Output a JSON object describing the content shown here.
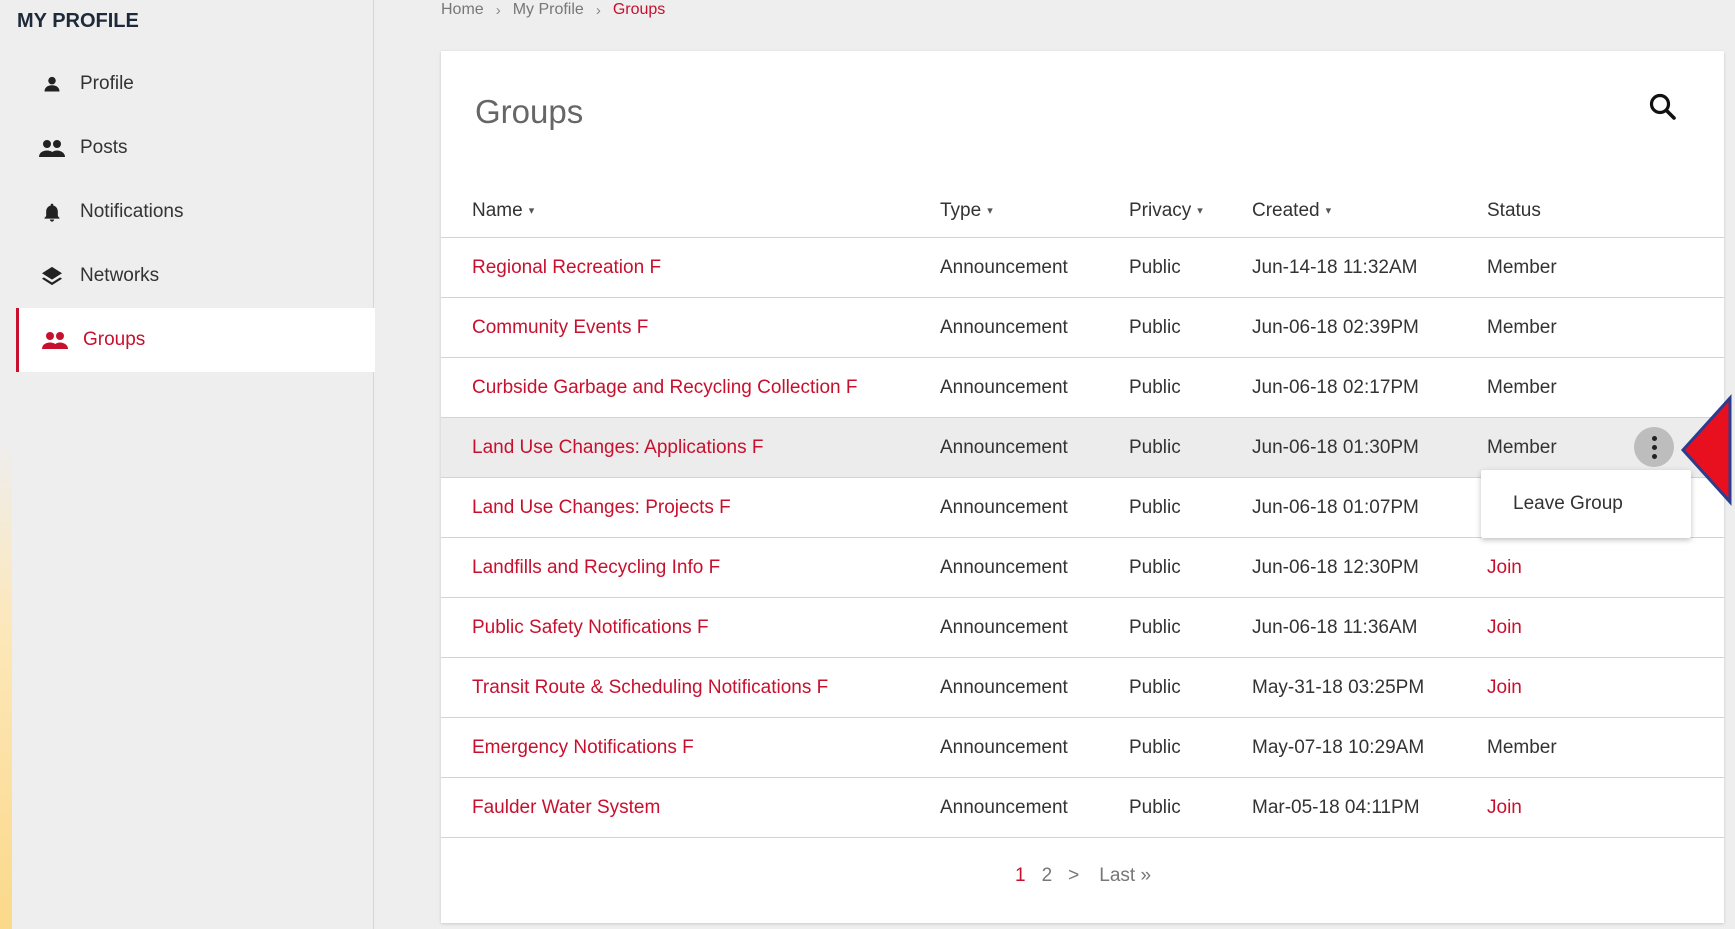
{
  "sidebar": {
    "title": "MY PROFILE",
    "items": [
      {
        "label": "Profile",
        "icon": "person-icon"
      },
      {
        "label": "Posts",
        "icon": "people-icon"
      },
      {
        "label": "Notifications",
        "icon": "bell-icon"
      },
      {
        "label": "Networks",
        "icon": "layers-icon"
      },
      {
        "label": "Groups",
        "icon": "people-icon",
        "active": true
      }
    ]
  },
  "breadcrumb": {
    "home": "Home",
    "profile": "My Profile",
    "current": "Groups",
    "separator": "›"
  },
  "page": {
    "title": "Groups"
  },
  "table": {
    "headers": {
      "name": "Name",
      "type": "Type",
      "privacy": "Privacy",
      "created": "Created",
      "status": "Status"
    },
    "rows": [
      {
        "name": "Regional Recreation F",
        "type": "Announcement",
        "privacy": "Public",
        "created": "Jun-14-18 11:32AM",
        "status": "Member"
      },
      {
        "name": "Community Events F",
        "type": "Announcement",
        "privacy": "Public",
        "created": "Jun-06-18 02:39PM",
        "status": "Member"
      },
      {
        "name": "Curbside Garbage and Recycling Collection F",
        "type": "Announcement",
        "privacy": "Public",
        "created": "Jun-06-18 02:17PM",
        "status": "Member"
      },
      {
        "name": "Land Use Changes: Applications F",
        "type": "Announcement",
        "privacy": "Public",
        "created": "Jun-06-18 01:30PM",
        "status": "Member"
      },
      {
        "name": "Land Use Changes: Projects F",
        "type": "Announcement",
        "privacy": "Public",
        "created": "Jun-06-18 01:07PM",
        "status": ""
      },
      {
        "name": "Landfills and Recycling Info F",
        "type": "Announcement",
        "privacy": "Public",
        "created": "Jun-06-18 12:30PM",
        "status": "Join"
      },
      {
        "name": "Public Safety Notifications F",
        "type": "Announcement",
        "privacy": "Public",
        "created": "Jun-06-18 11:36AM",
        "status": "Join"
      },
      {
        "name": "Transit Route & Scheduling Notifications F",
        "type": "Announcement",
        "privacy": "Public",
        "created": "May-31-18 03:25PM",
        "status": "Join"
      },
      {
        "name": "Emergency Notifications F",
        "type": "Announcement",
        "privacy": "Public",
        "created": "May-07-18 10:29AM",
        "status": "Member"
      },
      {
        "name": "Faulder Water System",
        "type": "Announcement",
        "privacy": "Public",
        "created": "Mar-05-18 04:11PM",
        "status": "Join"
      }
    ]
  },
  "menu": {
    "leave_group": "Leave Group"
  },
  "pagination": {
    "current": "1",
    "page2": "2",
    "next": ">",
    "last": "Last »"
  },
  "colors": {
    "accent": "#c8102e",
    "pointer_arrow": "#e8101e",
    "pointer_outline": "#2b3d8f"
  }
}
